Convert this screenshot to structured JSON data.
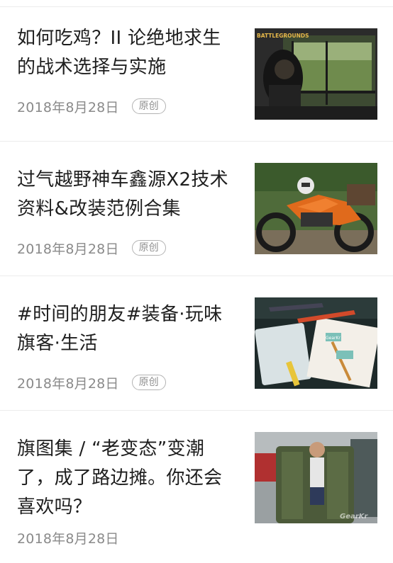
{
  "articles": [
    {
      "title_line1": "如何吃鸡？II 论绝地求生",
      "title_line2": "的战术选择与实施",
      "title_line3": "",
      "date": "2018年8月28日",
      "badge": "原创",
      "thumb_caption": "BATTLEGROUNDS"
    },
    {
      "title_line1": "过气越野神车鑫源X2技术",
      "title_line2": "资料&改装范例合集",
      "title_line3": "",
      "date": "2018年8月28日",
      "badge": "原创"
    },
    {
      "title_line1": "#时间的朋友#装备·玩味",
      "title_line2": "旗客·生活",
      "title_line3": "",
      "date": "2018年8月28日",
      "badge": "原创",
      "thumb_caption": "GearKr"
    },
    {
      "title_line1": "旗图集 / “老变态”变潮",
      "title_line2": "了，成了路边摊。你还会",
      "title_line3": "喜欢吗？",
      "date": "2018年8月28日",
      "badge": "",
      "thumb_caption": "GearKr"
    }
  ]
}
